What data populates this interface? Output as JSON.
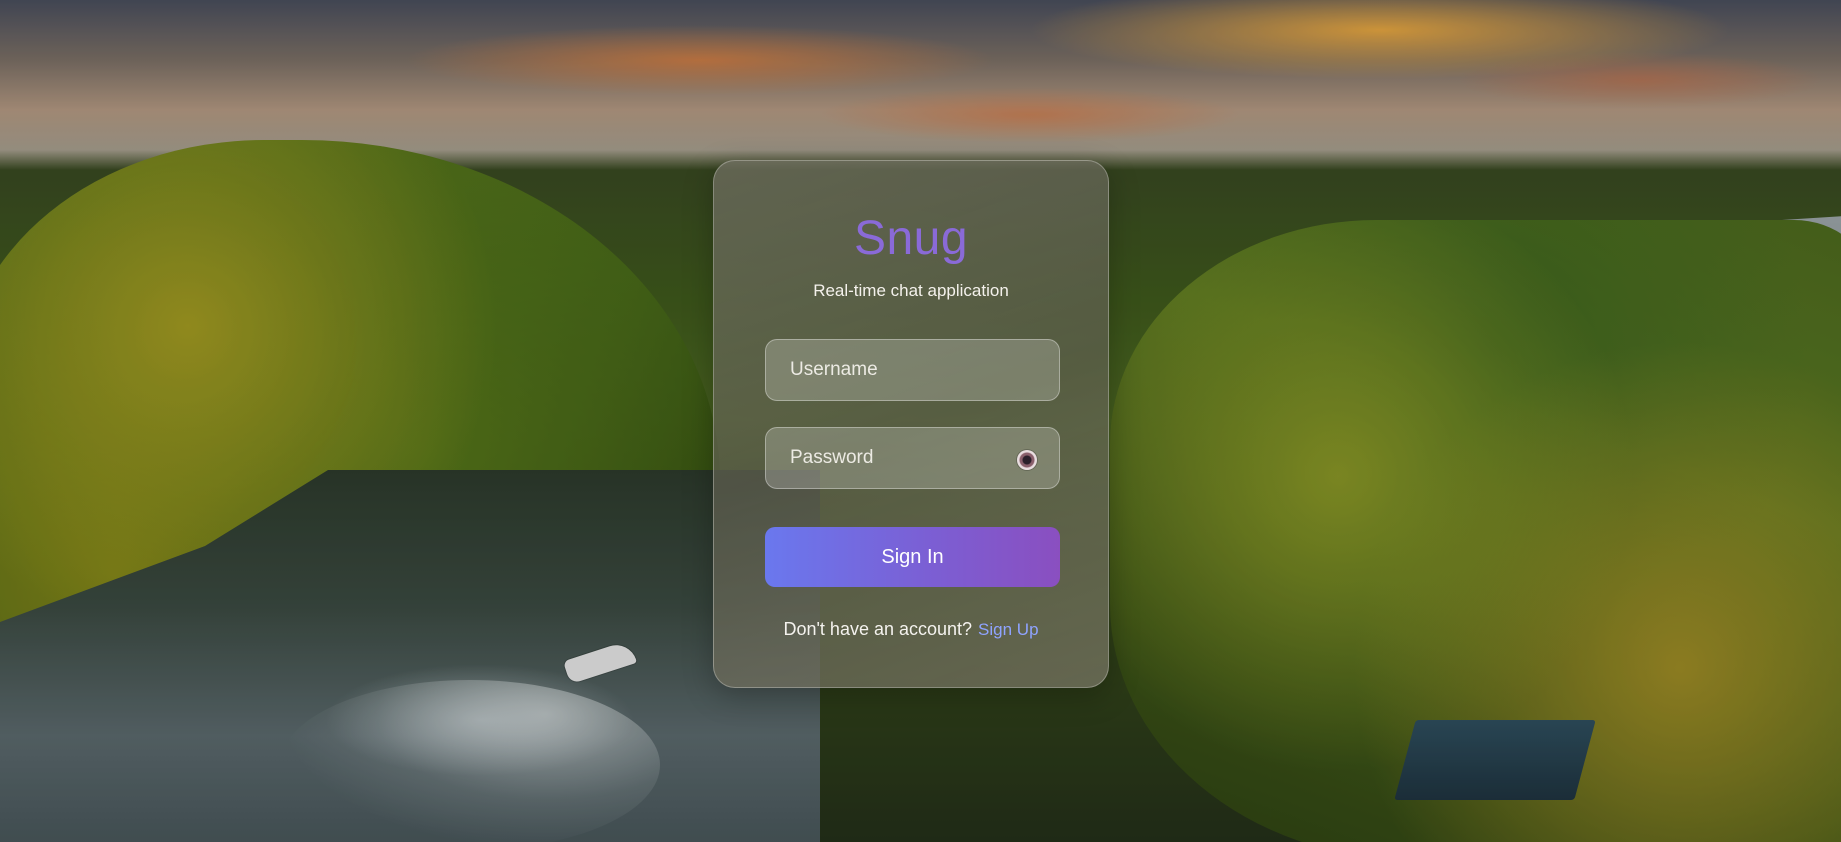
{
  "app": {
    "brand": "Snug",
    "tagline": "Real-time chat application"
  },
  "form": {
    "username_placeholder": "Username",
    "username_value": "",
    "password_placeholder": "Password",
    "password_value": "",
    "password_toggle_icon": "eye-icon",
    "submit_label": "Sign In"
  },
  "footer": {
    "prompt": "Don't have an account?",
    "link_label": "Sign Up"
  },
  "colors": {
    "brand": "#8a6ad8",
    "button_gradient_start": "#6a78ee",
    "button_gradient_end": "#8a4fc0",
    "link": "#8fa3ff"
  }
}
